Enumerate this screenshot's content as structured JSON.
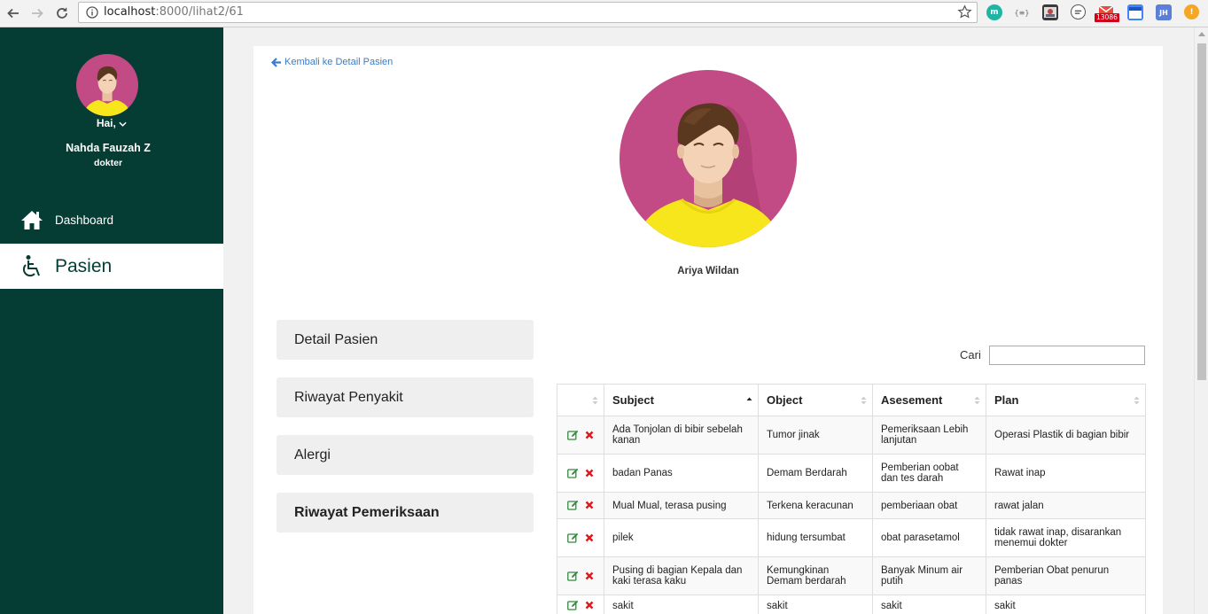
{
  "browser": {
    "url_host": "localhost",
    "url_rest": ":8000/lihat2/61",
    "extensions": [
      "m-extension-icon",
      "json-extension-icon",
      "photo-extension-icon",
      "line-extension-icon",
      "gmail-extension-icon",
      "calendar-extension-icon",
      "jh-extension-icon",
      "alert-extension-icon"
    ],
    "ext_labels": {
      "m": "m",
      "json": "{≡}",
      "gmail_badge": "13086",
      "jh": "JH",
      "alert": "!"
    }
  },
  "sidebar": {
    "greeting": "Hai,",
    "doctor_name": "Nahda Fauzah Z",
    "role": "dokter",
    "menu": [
      {
        "label": "Dashboard",
        "icon": "home-icon",
        "active": false
      },
      {
        "label": "Pasien",
        "icon": "wheelchair-icon",
        "active": true
      }
    ],
    "bg_color": "#053d34"
  },
  "main": {
    "back_link": "Kembali ke Detail Pasien",
    "patient_name": "Ariya Wildan",
    "tabs": [
      {
        "label": "Detail Pasien",
        "active": false
      },
      {
        "label": "Riwayat Penyakit",
        "active": false
      },
      {
        "label": "Alergi",
        "active": false
      },
      {
        "label": "Riwayat Pemeriksaan",
        "active": true
      }
    ],
    "search_label": "Cari",
    "search_value": "",
    "table": {
      "headers": [
        "",
        "Subject",
        "Object",
        "Asesement",
        "Plan"
      ],
      "sorted_column": "Subject",
      "rows": [
        {
          "subject": "Ada Tonjolan di bibir sebelah kanan",
          "object": "Tumor jinak",
          "assessment": "Pemeriksaan Lebih lanjutan",
          "plan": "Operasi Plastik di bagian bibir"
        },
        {
          "subject": "badan Panas",
          "object": "Demam Berdarah",
          "assessment": "Pemberian oobat dan tes darah",
          "plan": "Rawat inap"
        },
        {
          "subject": "Mual Mual, terasa pusing",
          "object": "Terkena keracunan",
          "assessment": "pemberiaan obat",
          "plan": "rawat jalan"
        },
        {
          "subject": "pilek",
          "object": "hidung tersumbat",
          "assessment": "obat parasetamol",
          "plan": "tidak rawat inap, disarankan menemui dokter"
        },
        {
          "subject": "Pusing di bagian Kepala dan kaki terasa kaku",
          "object": "Kemungkinan Demam berdarah",
          "assessment": "Banyak Minum air putih",
          "plan": "Pemberian Obat penurun panas"
        },
        {
          "subject": "sakit",
          "object": "sakit",
          "assessment": "sakit",
          "plan": "sakit"
        }
      ]
    },
    "colors": {
      "link": "#3a7cc7",
      "avatar_bg": "#c24b85",
      "shirt": "#f7e61c",
      "edit": "#2e8b3a",
      "delete": "#e0171b"
    }
  }
}
